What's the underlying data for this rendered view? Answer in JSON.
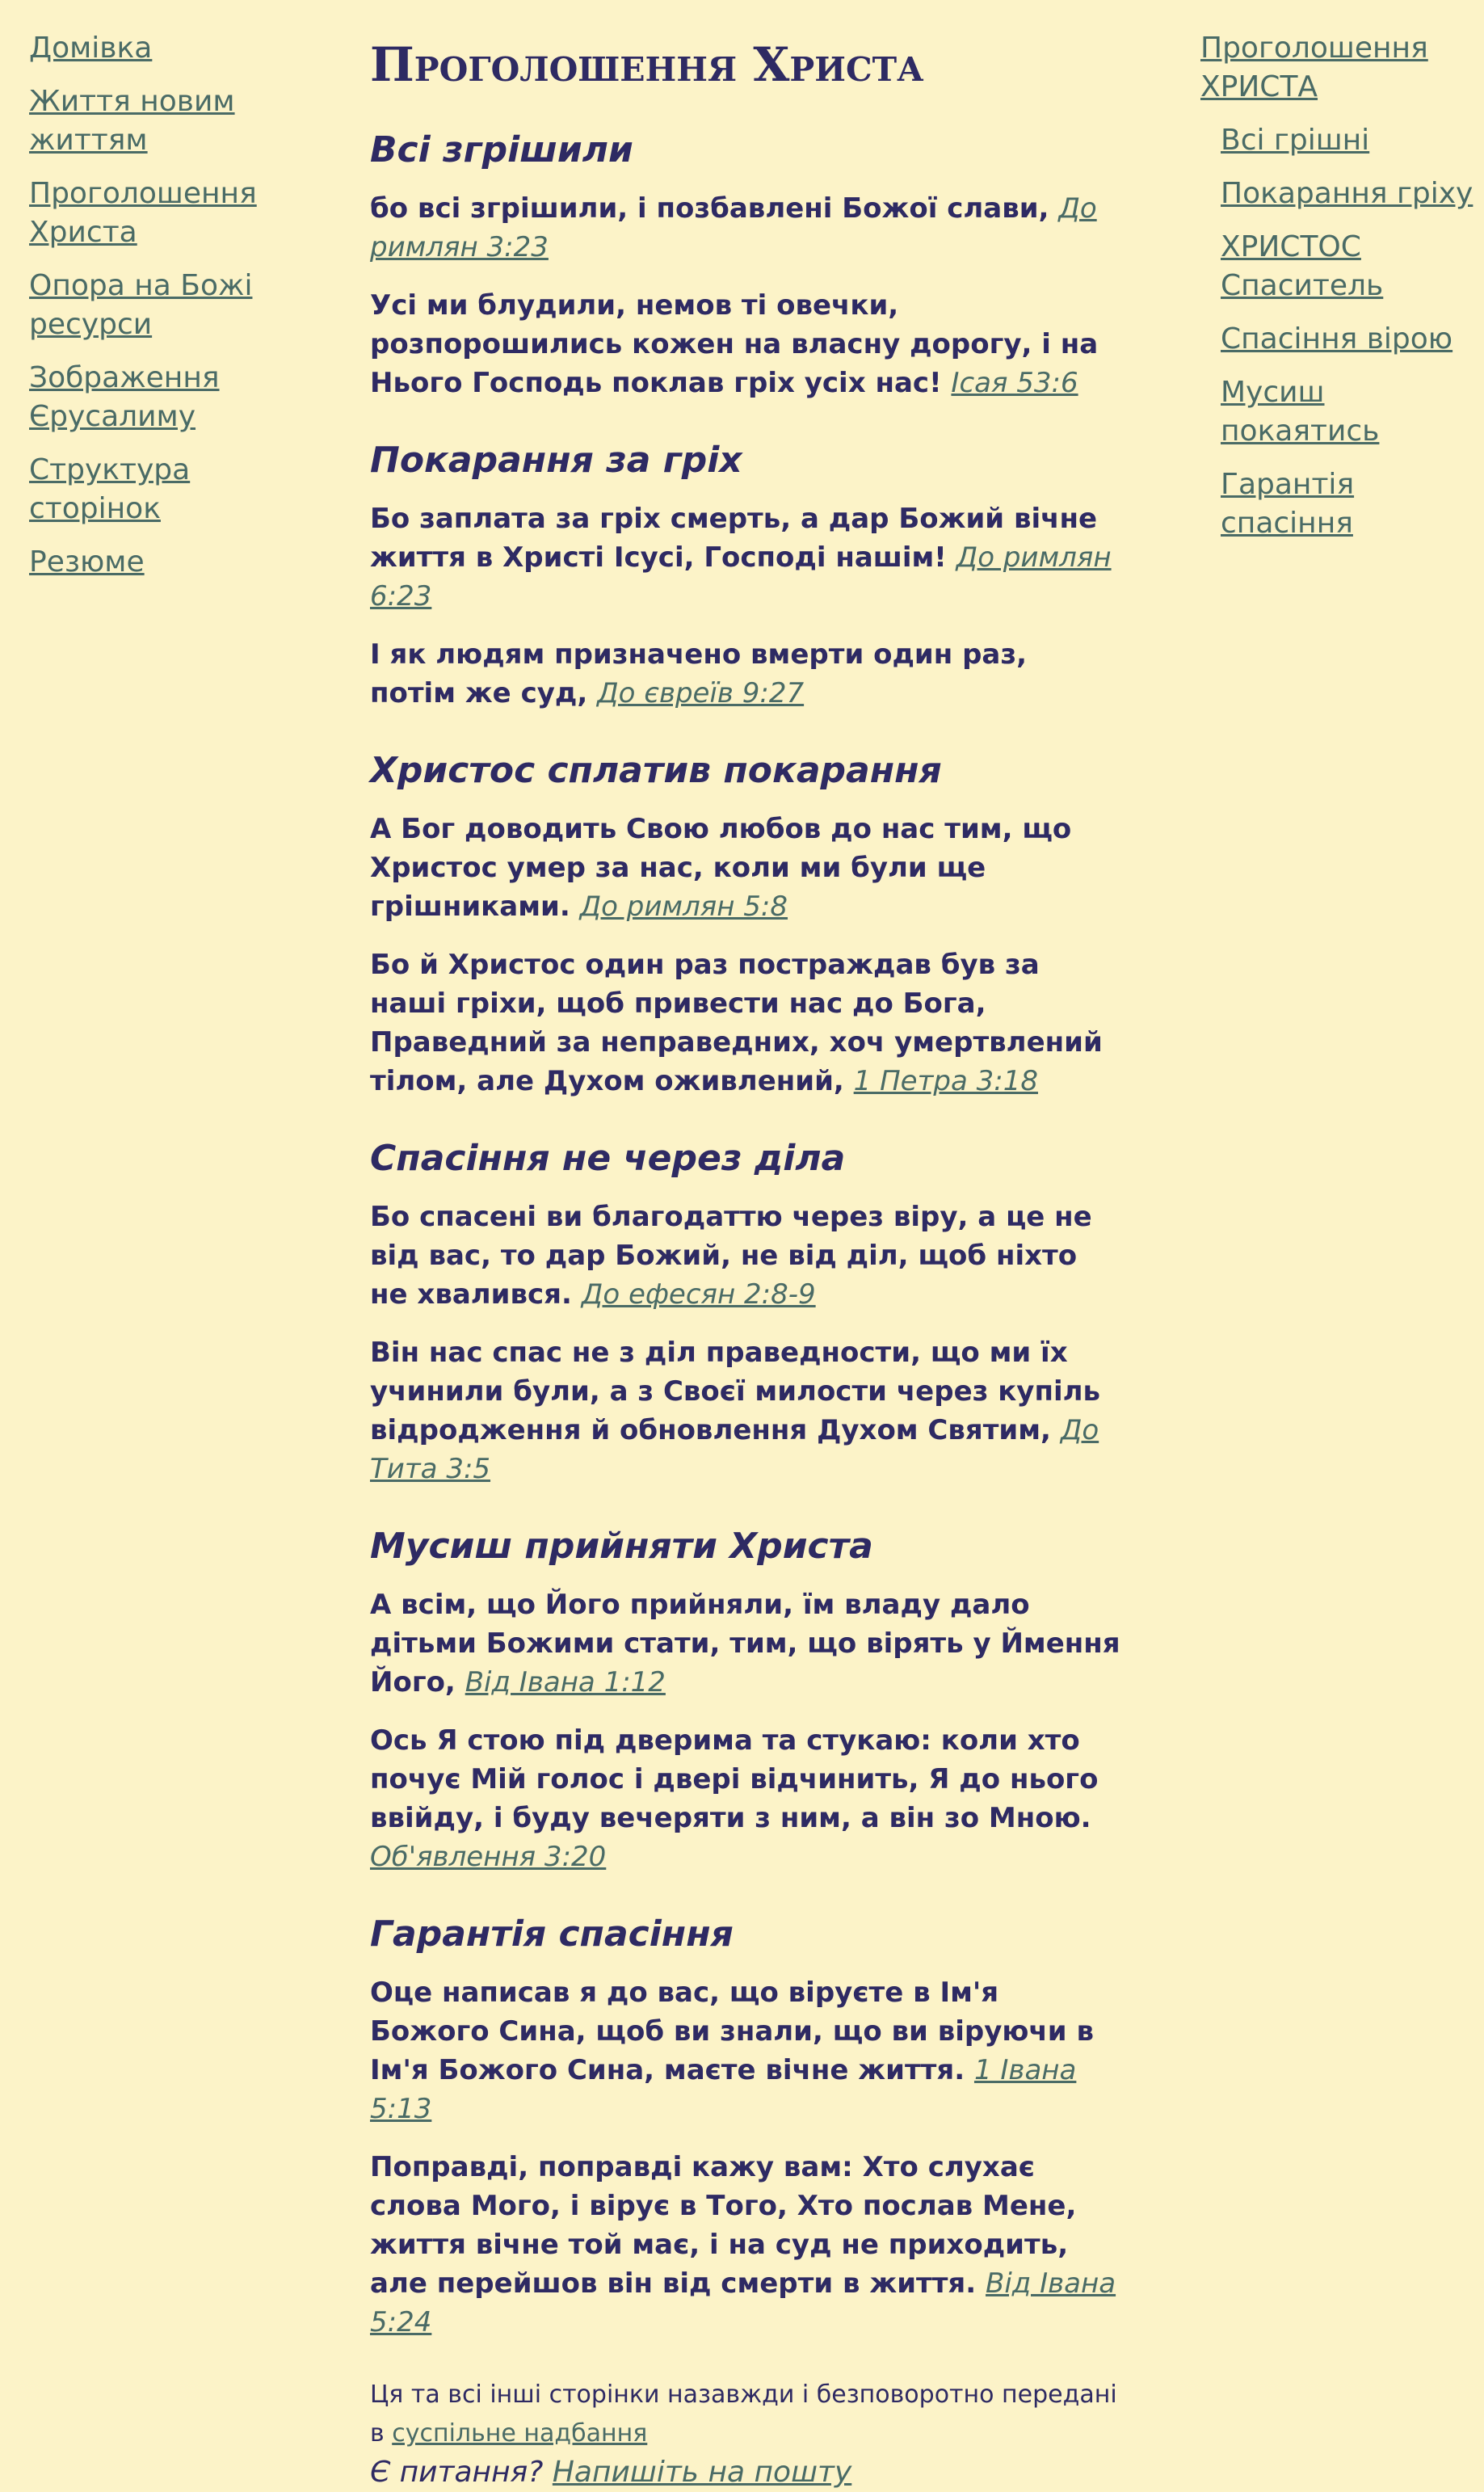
{
  "left_nav": [
    "Домівка",
    "Життя новим життям",
    "Проголошення Христа",
    "Опора на Божі ресурси",
    "Зображення Єрусалиму",
    "Структура сторінок",
    "Резюме"
  ],
  "right_nav": {
    "top": "Проголошення ХРИСТА",
    "items": [
      "Всі грішні",
      "Покарання гріху",
      "ХРИСТОС Спаситель",
      "Спасіння вірою",
      "Мусиш покаятись",
      "Гарантія спасіння"
    ]
  },
  "page_title": "Проголошення Христа",
  "sections": [
    {
      "title": "Всі згрішили",
      "verses": [
        {
          "text": "бо всі згрішили, і позбавлені Божої слави, ",
          "ref": "До римлян 3:23"
        },
        {
          "text": "Усі ми блудили, немов ті овечки, розпорошились кожен на власну дорогу, і на Нього Господь поклав гріх усіх нас! ",
          "ref": "Ісая 53:6"
        }
      ]
    },
    {
      "title": "Покарання за гріх",
      "verses": [
        {
          "text": "Бо заплата за гріх смерть, а дар Божий вічне життя в Христі Ісусі, Господі нашім! ",
          "ref": "До римлян 6:23"
        },
        {
          "text": "І як людям призначено вмерти один раз, потім же суд, ",
          "ref": "До євреїв 9:27"
        }
      ]
    },
    {
      "title": "Христос сплатив покарання",
      "verses": [
        {
          "text": "А Бог доводить Свою любов до нас тим, що Христос умер за нас, коли ми були ще грішниками. ",
          "ref": "До римлян 5:8"
        },
        {
          "text": "Бо й Христос один раз постраждав був за наші гріхи, щоб привести нас до Бога, Праведний за неправедних, хоч умертвлений тілом, але Духом оживлений, ",
          "ref": "1 Петра 3:18"
        }
      ]
    },
    {
      "title": "Спасіння не через діла",
      "verses": [
        {
          "text": "Бо спасені ви благодаттю через віру, а це не від вас, то дар Божий, не від діл, щоб ніхто не хвалився. ",
          "ref": "До ефесян 2:8-9"
        },
        {
          "text": "Він нас спас не з діл праведности, що ми їх учинили були, а з Своєї милости через купіль відродження й обновлення Духом Святим, ",
          "ref": "До Тита 3:5"
        }
      ]
    },
    {
      "title": "Мусиш прийняти Христа",
      "verses": [
        {
          "text": "А всім, що Його прийняли, їм владу дало дітьми Божими стати, тим, що вірять у Ймення Його, ",
          "ref": "Від Івана 1:12"
        },
        {
          "text": "Ось Я стою під дверима та стукаю: коли хто почує Мій голос і двері відчинить, Я до нього ввійду, і буду вечеряти з ним, а він зо Мною. ",
          "ref": "Об'явлення 3:20"
        }
      ]
    },
    {
      "title": "Гарантія спасіння",
      "verses": [
        {
          "text": "Оце написав я до вас, що віруєте в Ім'я Божого Сина, щоб ви знали, що ви віруючи в Ім'я Божого Сина, маєте вічне життя. ",
          "ref": "1 Івана 5:13"
        },
        {
          "text": "Поправді, поправді кажу вам: Хто слухає слова Мого, і вірує в Того, Хто послав Мене, життя вічне той має, і на суд не приходить, але перейшов він від смерти в життя. ",
          "ref": "Від Івана 5:24"
        }
      ]
    }
  ],
  "footer": {
    "line_text": "Ця та всі інші сторінки назавжди і безповоротно передані в ",
    "line_link": "суспільне надбання",
    "question": "Є питання? ",
    "question_link": "Напишіть на пошту"
  }
}
